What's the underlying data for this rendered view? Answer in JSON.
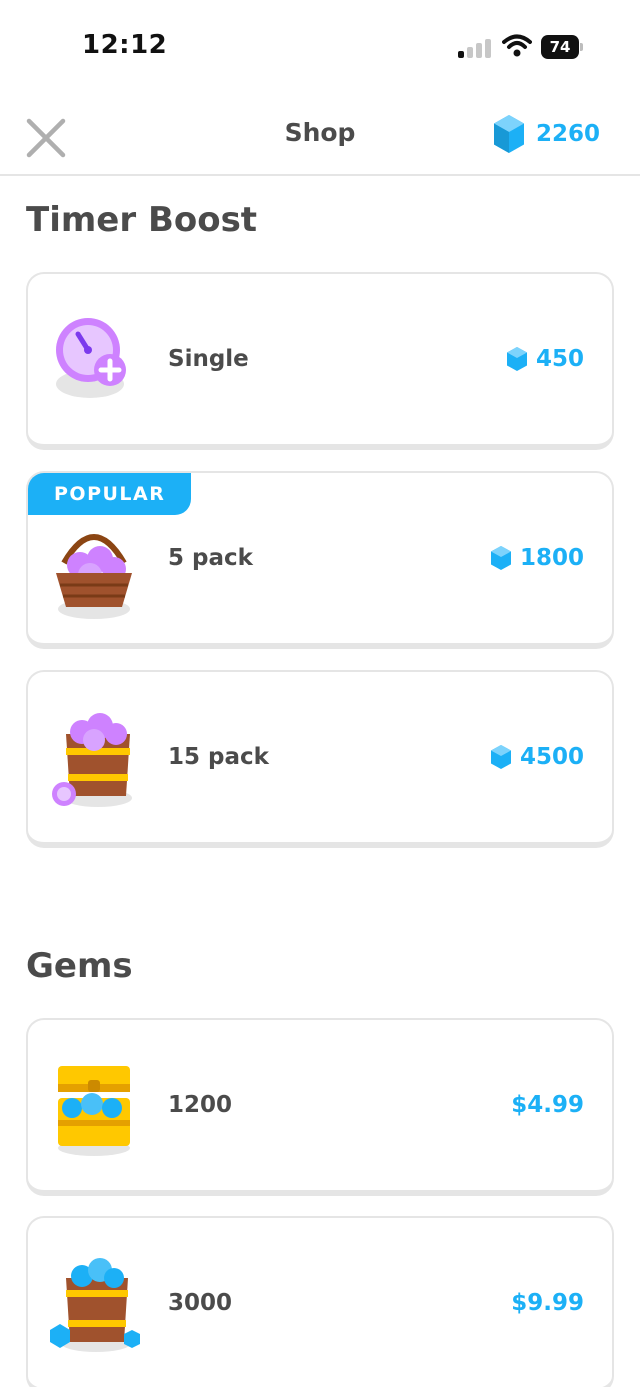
{
  "status_bar": {
    "time": "12:12",
    "battery": "74"
  },
  "header": {
    "title": "Shop",
    "gem_balance": "2260"
  },
  "sections": [
    {
      "title": "Timer Boost",
      "items": [
        {
          "label": "Single",
          "price": "450",
          "icon": "timer-single-icon"
        },
        {
          "label": "5 pack",
          "price": "1800",
          "badge": "POPULAR",
          "icon": "timer-basket-icon"
        },
        {
          "label": "15 pack",
          "price": "4500",
          "icon": "timer-barrel-icon"
        }
      ]
    },
    {
      "title": "Gems",
      "items": [
        {
          "label": "1200",
          "price": "$4.99",
          "icon": "gem-chest-icon"
        },
        {
          "label": "3000",
          "price": "$9.99",
          "icon": "gem-barrel-icon"
        }
      ]
    }
  ],
  "colors": {
    "accent": "#1cb0f6",
    "text": "#4b4b4b",
    "border": "#e5e5e5",
    "timer": "#ce82ff"
  }
}
